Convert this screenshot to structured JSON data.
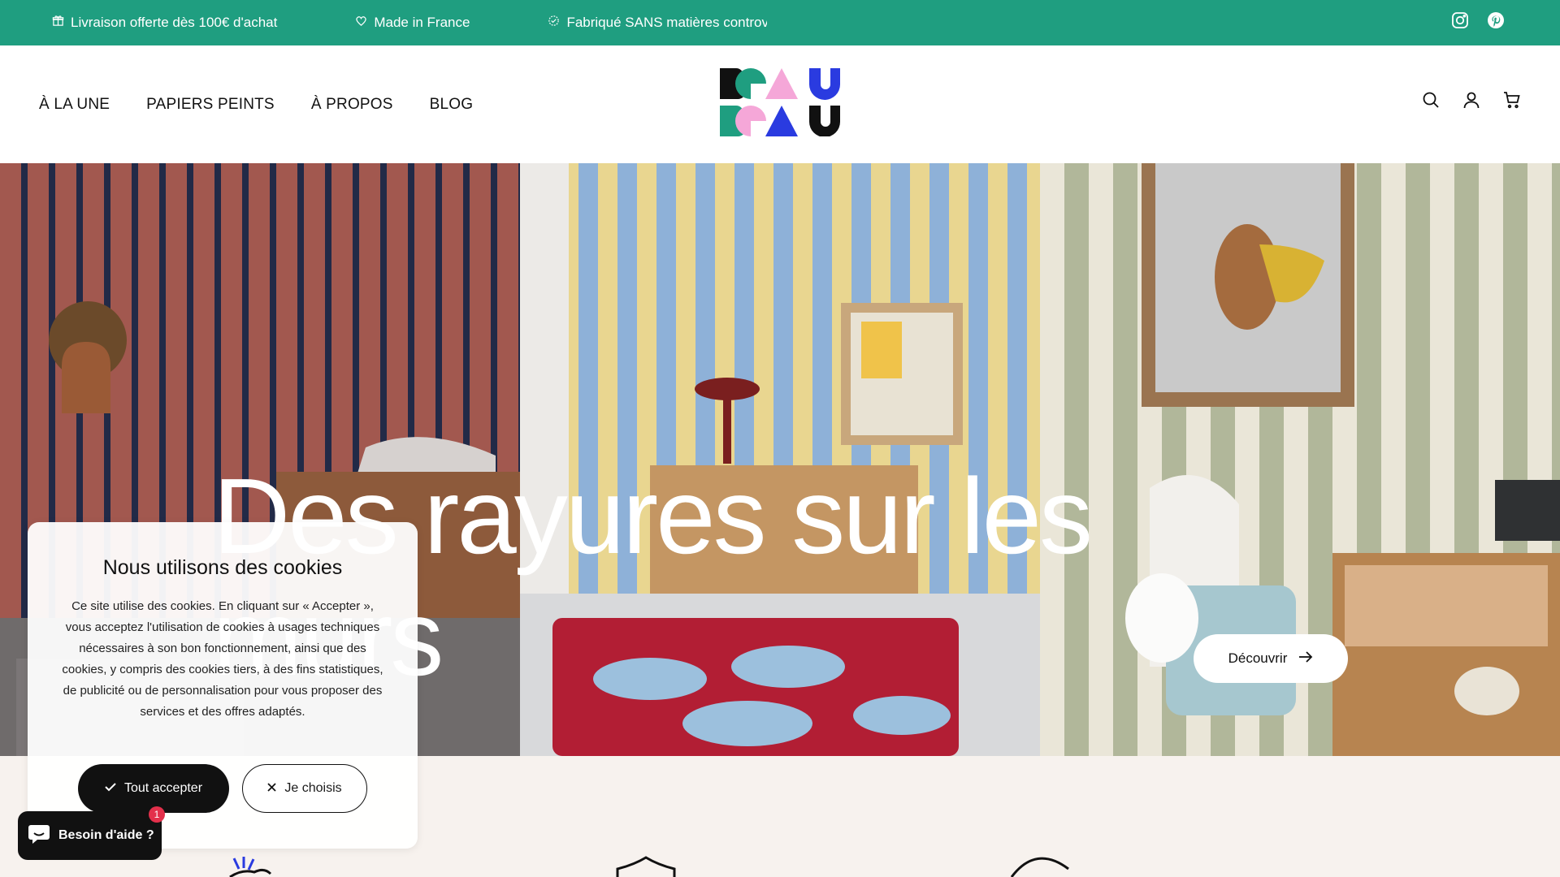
{
  "announcement": {
    "items": [
      "Livraison offerte dès 100€ d'achat",
      "Made in France",
      "Fabriqué SANS matières controve"
    ],
    "icons": [
      "gift-icon",
      "heart-icon",
      "leaf-badge-icon"
    ]
  },
  "social": [
    "instagram-icon",
    "pinterest-icon"
  ],
  "nav": {
    "items": [
      "À LA UNE",
      "PAPIERS PEINTS",
      "À PROPOS",
      "BLOG"
    ]
  },
  "logo": {
    "lines": [
      "BEAU",
      "BEAU"
    ],
    "colors": [
      "#111111",
      "#1f9e80",
      "#f5a7d8",
      "#2a3be0"
    ]
  },
  "header_icons": [
    "search-icon",
    "account-icon",
    "cart-icon"
  ],
  "hero": {
    "title": "Des rayures sur les murs",
    "cta_label": "Découvrir"
  },
  "cookie": {
    "title": "Nous utilisons des cookies",
    "body": "Ce site utilise des cookies. En cliquant sur « Accepter », vous acceptez l'utilisation de cookies à usages techniques nécessaires à son bon fonctionnement, ainsi que des cookies, y compris des cookies tiers, à des fins statistiques, de publicité ou de personnalisation pour vous proposer des services et des offres adaptés.",
    "accept_label": "Tout accepter",
    "choose_label": "Je choisis"
  },
  "chat": {
    "label": "Besoin d'aide ?",
    "badge": "1"
  },
  "colors": {
    "accent": "#1f9e80",
    "badge": "#e3304b"
  }
}
